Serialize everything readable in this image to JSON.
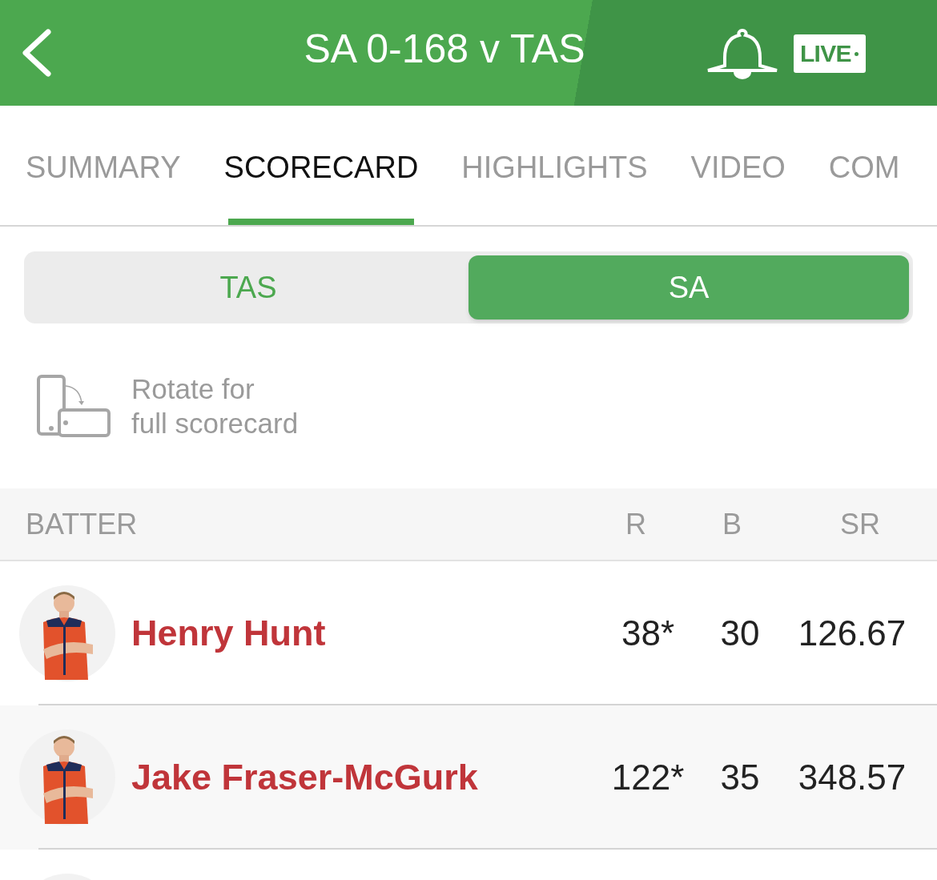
{
  "header": {
    "title": "SA 0-168 v TAS",
    "live_badge": "LIVE"
  },
  "tabs": [
    {
      "label": "SUMMARY",
      "selected": false
    },
    {
      "label": "SCORECARD",
      "selected": true
    },
    {
      "label": "HIGHLIGHTS",
      "selected": false
    },
    {
      "label": "VIDEO",
      "selected": false
    },
    {
      "label": "COM",
      "selected": false
    }
  ],
  "teams": [
    {
      "label": "TAS",
      "selected": false
    },
    {
      "label": "SA",
      "selected": true
    }
  ],
  "rotate_hint": [
    "Rotate for",
    "full scorecard"
  ],
  "table": {
    "columns": [
      "BATTER",
      "R",
      "B",
      "SR"
    ],
    "rows": [
      {
        "name": "Henry Hunt",
        "runs": "38*",
        "balls": "30",
        "strike_rate": "126.67"
      },
      {
        "name": "Jake Fraser-McGurk",
        "runs": "122*",
        "balls": "35",
        "strike_rate": "348.57"
      }
    ]
  }
}
